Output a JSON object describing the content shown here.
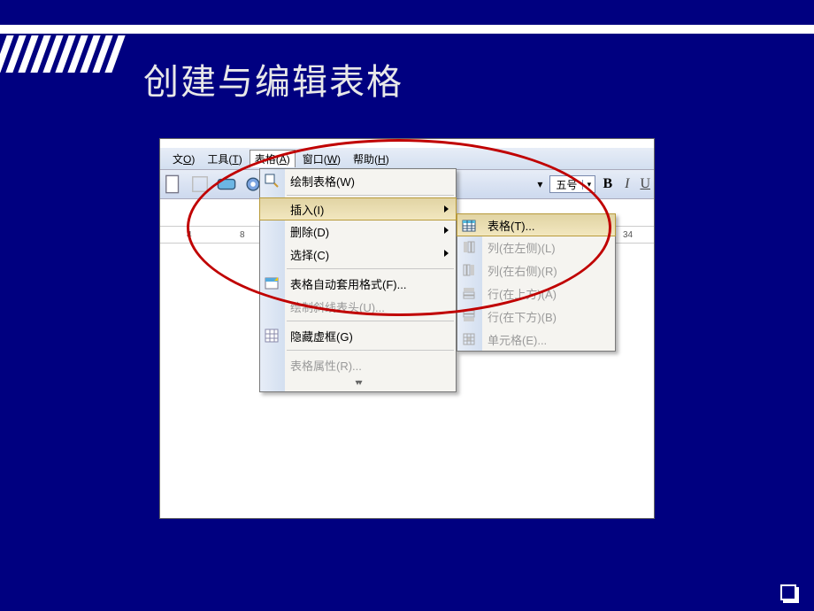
{
  "slide": {
    "title": "创建与编辑表格"
  },
  "menubar": {
    "items": [
      {
        "prefix": "文",
        "hot": "O",
        "suffix": ")"
      },
      {
        "prefix": "工具(",
        "hot": "T",
        "suffix": ")"
      },
      {
        "prefix": "表格(",
        "hot": "A",
        "suffix": ")"
      },
      {
        "prefix": "窗口(",
        "hot": "W",
        "suffix": ")"
      },
      {
        "prefix": "帮助(",
        "hot": "H",
        "suffix": ")"
      }
    ]
  },
  "toolbar": {
    "fontsize": "五号",
    "bold": "B",
    "italic": "I",
    "underline": "U"
  },
  "ruler": {
    "marks": [
      "4",
      "8",
      "34"
    ]
  },
  "main_menu": {
    "items": [
      {
        "label": "绘制表格(W)",
        "icon": "draw-table",
        "enabled": true
      },
      {
        "label": "插入(I)",
        "icon": "",
        "enabled": true,
        "submenu": true,
        "selected": true
      },
      {
        "label": "删除(D)",
        "icon": "",
        "enabled": true,
        "submenu": true
      },
      {
        "label": "选择(C)",
        "icon": "",
        "enabled": true,
        "submenu": true
      },
      {
        "label": "表格自动套用格式(F)...",
        "icon": "autoformat",
        "enabled": true
      },
      {
        "label": "绘制斜线表头(U)...",
        "icon": "",
        "enabled": false
      },
      {
        "label": "隐藏虚框(G)",
        "icon": "hide-grid",
        "enabled": true
      },
      {
        "label": "表格属性(R)...",
        "icon": "",
        "enabled": false
      }
    ]
  },
  "sub_menu": {
    "items": [
      {
        "label": "表格(T)...",
        "icon": "table",
        "enabled": true,
        "selected": true
      },
      {
        "label": "列(在左侧)(L)",
        "icon": "col-left",
        "enabled": false
      },
      {
        "label": "列(在右侧)(R)",
        "icon": "col-right",
        "enabled": false
      },
      {
        "label": "行(在上方)(A)",
        "icon": "row-above",
        "enabled": false
      },
      {
        "label": "行(在下方)(B)",
        "icon": "row-below",
        "enabled": false
      },
      {
        "label": "单元格(E)...",
        "icon": "cell",
        "enabled": false
      }
    ]
  }
}
